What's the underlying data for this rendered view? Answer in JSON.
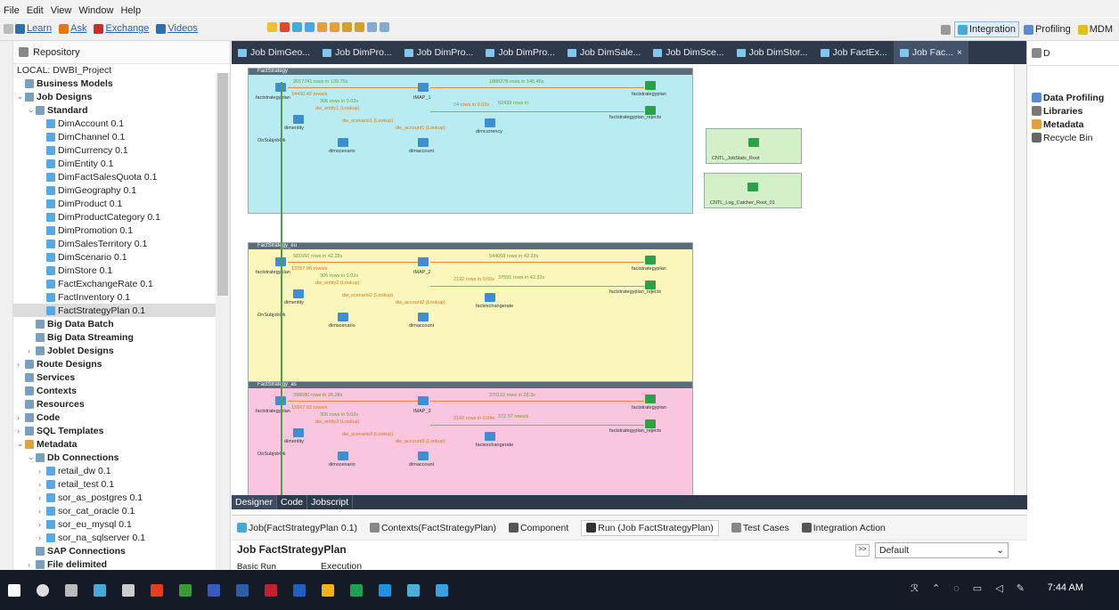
{
  "menubar": {
    "items": [
      "File",
      "Edit",
      "View",
      "Window",
      "Help"
    ]
  },
  "toolbar": {
    "links": [
      {
        "label": "Learn",
        "color": "#2c6fb6"
      },
      {
        "label": "Ask",
        "color": "#e07a10"
      },
      {
        "label": "Exchange",
        "color": "#d02a2a"
      },
      {
        "label": "Videos",
        "color": "#2c6fb6"
      }
    ],
    "perspectives": [
      {
        "label": "Integration",
        "active": true
      },
      {
        "label": "Profiling",
        "active": false
      },
      {
        "label": "MDM",
        "active": false
      }
    ]
  },
  "repository": {
    "title": "Repository",
    "project": "LOCAL: DWBI_Project",
    "items": [
      {
        "label": "Business Models",
        "bold": true,
        "level": 1,
        "arrow": ""
      },
      {
        "label": "Job Designs",
        "bold": true,
        "level": 1,
        "arrow": "v"
      },
      {
        "label": "Standard",
        "bold": true,
        "level": 2,
        "arrow": "v"
      },
      {
        "label": "DimAccount 0.1",
        "level": 3
      },
      {
        "label": "DimChannel 0.1",
        "level": 3
      },
      {
        "label": "DimCurrency 0.1",
        "level": 3
      },
      {
        "label": "DimEntity 0.1",
        "level": 3
      },
      {
        "label": "DimFactSalesQuota 0.1",
        "level": 3
      },
      {
        "label": "DimGeography 0.1",
        "level": 3
      },
      {
        "label": "DimProduct 0.1",
        "level": 3
      },
      {
        "label": "DimProductCategory 0.1",
        "level": 3
      },
      {
        "label": "DimPromotion 0.1",
        "level": 3
      },
      {
        "label": "DimSalesTerritory 0.1",
        "level": 3
      },
      {
        "label": "DimScenario 0.1",
        "level": 3
      },
      {
        "label": "DimStore 0.1",
        "level": 3
      },
      {
        "label": "FactExchangeRate 0.1",
        "level": 3
      },
      {
        "label": "FactInventory 0.1",
        "level": 3
      },
      {
        "label": "FactStrategyPlan 0.1",
        "level": 3,
        "selected": true
      },
      {
        "label": "Big Data Batch",
        "bold": true,
        "level": 2
      },
      {
        "label": "Big Data Streaming",
        "bold": true,
        "level": 2
      },
      {
        "label": "Joblet Designs",
        "bold": true,
        "level": 2,
        "arrow": ">"
      },
      {
        "label": "Route Designs",
        "bold": true,
        "level": 1,
        "arrow": ">"
      },
      {
        "label": "Services",
        "bold": true,
        "level": 1
      },
      {
        "label": "Contexts",
        "bold": true,
        "level": 1
      },
      {
        "label": "Resources",
        "bold": true,
        "level": 1
      },
      {
        "label": "Code",
        "bold": true,
        "level": 1,
        "arrow": ">"
      },
      {
        "label": "SQL Templates",
        "bold": true,
        "level": 1,
        "arrow": ">"
      },
      {
        "label": "Metadata",
        "bold": true,
        "level": 1,
        "arrow": "v"
      },
      {
        "label": "Db Connections",
        "bold": true,
        "level": 2,
        "arrow": "v"
      },
      {
        "label": "retail_dw 0.1",
        "level": 3,
        "arrow": ">"
      },
      {
        "label": "retail_test 0.1",
        "level": 3,
        "arrow": ">"
      },
      {
        "label": "sor_as_postgres 0.1",
        "level": 3,
        "arrow": ">"
      },
      {
        "label": "sor_cat_oracle 0.1",
        "level": 3,
        "arrow": ">"
      },
      {
        "label": "sor_eu_mysql 0.1",
        "level": 3,
        "arrow": ">"
      },
      {
        "label": "sor_na_sqlserver 0.1",
        "level": 3,
        "arrow": ">"
      },
      {
        "label": "SAP Connections",
        "bold": true,
        "level": 2
      },
      {
        "label": "File delimited",
        "bold": true,
        "level": 2,
        "arrow": ">"
      }
    ]
  },
  "editor_tabs": [
    {
      "label": "Job DimGeo..."
    },
    {
      "label": "Job DimPro..."
    },
    {
      "label": "Job DimPro..."
    },
    {
      "label": "Job DimPro..."
    },
    {
      "label": "Job DimSale..."
    },
    {
      "label": "Job DimSce..."
    },
    {
      "label": "Job DimStor..."
    },
    {
      "label": "Job FactEx..."
    },
    {
      "label": "Job Fac...",
      "active": true
    }
  ],
  "canvas": {
    "subjobs": [
      {
        "title": "FactStrategy",
        "color": "#b9ecf2",
        "c1": "factstrategyplan",
        "c2": "tMAP_1",
        "rows1": "2017741 rows in 139.75s",
        "rows2": "14430.42 rows/s",
        "rows3": "1888278 rows in 145.46s",
        "rows4": "306 rows in 0.02s",
        "rows5": "24 rows in 0.02s",
        "rows6": "82439 rows in",
        "out1": "factstrategyplan",
        "out2": "factstrategyplan_rejects",
        "l1": "dimentity",
        "l2": "dimscenario",
        "l3": "dimaccount",
        "l4": "dimcurrency",
        "onsub": "OnSubjobOk",
        "lk1": "dw_entity1 (Lookup)",
        "lk2": "dw_scenario1 (Lookup)",
        "lk3": "dw_account1 (Lookup)"
      },
      {
        "title": "FactStrategy_eu",
        "color": "#fbf7bc",
        "c1": "factstrategyplan",
        "c2": "tMAP_2",
        "rows1": "581650 rows in 42.28s",
        "rows2": "13757.96 rows/s",
        "rows3": "544068 rows in 42.33s",
        "rows4": "306 rows in 0.02s",
        "rows5": "2192 rows in 0.06s",
        "rows6": "37591 rows in 42.32s",
        "out1": "factstrategyplan",
        "out2": "factstrategyplan_rejects",
        "l1": "dimentity",
        "l2": "dimscenario",
        "l3": "dimaccount",
        "l4": "factexchangerate",
        "onsub": "OnSubjobOk",
        "lk1": "dw_entity2 (Lookup)",
        "lk2": "dw_scenario2 (Lookup)",
        "lk3": "dw_account2 (Lookup)"
      },
      {
        "title": "FactStrategy_as",
        "color": "#f9c5df",
        "c1": "factstrategyplan",
        "c2": "tMAP_3",
        "rows1": "398680 rows in 28.28s",
        "rows2": "13167.03 rows/s",
        "rows3": "370110 rows in 28.3s",
        "rows4": "306 rows in 0.02s",
        "rows5": "2192 rows in 0.04s",
        "rows6": "372.57 rows/s",
        "out1": "factstrategyplan",
        "out2": "factstrategyplan_rejects",
        "l1": "dimentity",
        "l2": "dimscenario",
        "l3": "dimaccount",
        "l4": "factexchangerate",
        "onsub": "OnSubjobOk",
        "lk1": "dw_entity3 (Lookup)",
        "lk2": "dw_scenario3 (Lookup)",
        "lk3": "dw_account3 (Lookup)"
      }
    ],
    "side_comps": [
      {
        "label": "CNTL_JobStats_Root"
      },
      {
        "label": "CNTL_Log_Catcher_Root_01"
      }
    ]
  },
  "design_tabs": [
    {
      "label": "Designer",
      "active": true
    },
    {
      "label": "Code"
    },
    {
      "label": "Jobscript"
    }
  ],
  "bottom_tabs": [
    {
      "label": "Job(FactStrategyPlan 0.1)"
    },
    {
      "label": "Contexts(FactStrategyPlan)"
    },
    {
      "label": "Component"
    },
    {
      "label": "Run (Job FactStrategyPlan)",
      "active": true
    },
    {
      "label": "Test Cases"
    },
    {
      "label": "Integration Action"
    }
  ],
  "run": {
    "job_title": "Job FactStrategyPlan",
    "basic_run": "Basic Run",
    "execution": "Execution",
    "context_select": "Default"
  },
  "right_panel": {
    "title": "D",
    "items": [
      {
        "label": "Data Profiling",
        "bold": true
      },
      {
        "label": "Libraries",
        "bold": true
      },
      {
        "label": "Metadata",
        "bold": true
      },
      {
        "label": "Recycle Bin",
        "bold": false
      }
    ]
  },
  "taskbar": {
    "time": "7:44 AM"
  }
}
